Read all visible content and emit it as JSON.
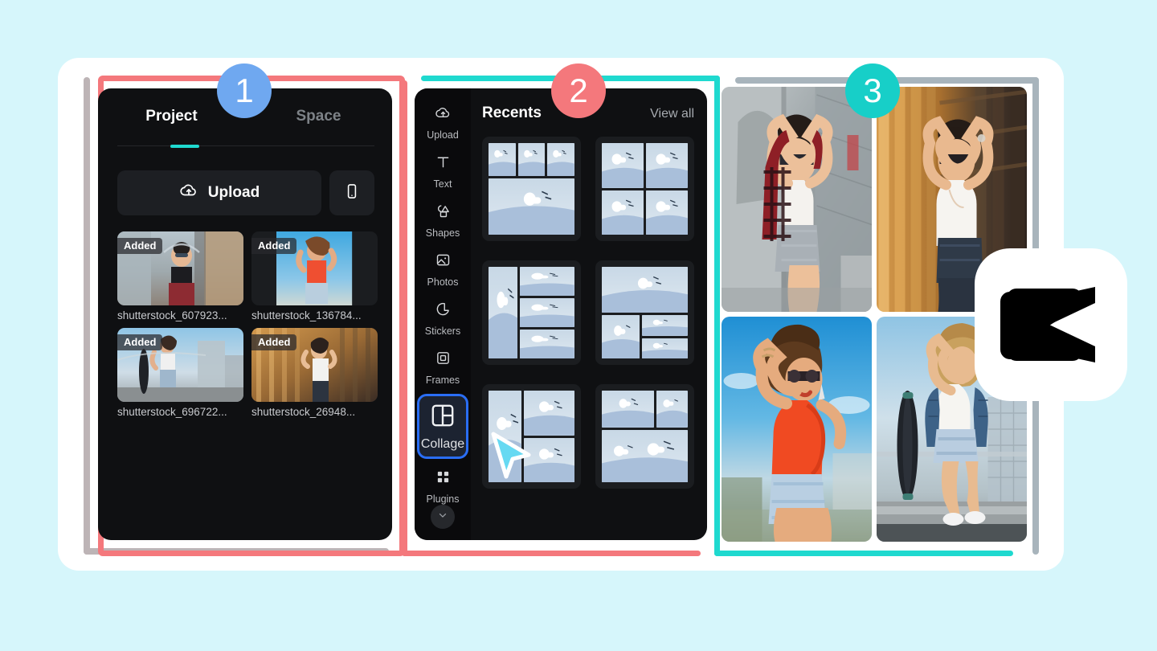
{
  "colors": {
    "background": "#d6f6fb",
    "card": "#ffffff",
    "panel": "#0f1012",
    "accent_teal": "#1fd9cf",
    "accent_red": "#f4787c",
    "accent_blue": "#6fa8f0",
    "selection_blue": "#2a6ef5",
    "gray_bracket": "#bdb4b6"
  },
  "badges": [
    {
      "label": "1",
      "color": "#6fa8f0"
    },
    {
      "label": "2",
      "color": "#f4787c"
    },
    {
      "label": "3",
      "color": "#17cfc8"
    }
  ],
  "panel_project": {
    "tabs": [
      {
        "label": "Project",
        "active": true
      },
      {
        "label": "Space",
        "active": false
      }
    ],
    "upload_label": "Upload",
    "upload_icon": "cloud-upload-icon",
    "mobile_icon": "mobile-phone-icon",
    "media": [
      {
        "badge": "Added",
        "filename": "shutterstock_607923..."
      },
      {
        "badge": "Added",
        "filename": "shutterstock_136784..."
      },
      {
        "badge": "Added",
        "filename": "shutterstock_696722..."
      },
      {
        "badge": "Added",
        "filename": "shutterstock_26948..."
      }
    ]
  },
  "panel_collage": {
    "rail": [
      {
        "label": "Upload",
        "icon": "cloud-upload-icon",
        "selected": false
      },
      {
        "label": "Text",
        "icon": "text-icon",
        "selected": false
      },
      {
        "label": "Shapes",
        "icon": "shapes-icon",
        "selected": false
      },
      {
        "label": "Photos",
        "icon": "image-icon",
        "selected": false
      },
      {
        "label": "Stickers",
        "icon": "sticker-icon",
        "selected": false
      },
      {
        "label": "Frames",
        "icon": "frame-icon",
        "selected": false
      },
      {
        "label": "Collage",
        "icon": "collage-icon",
        "selected": true
      },
      {
        "label": "Plugins",
        "icon": "grid-apps-icon",
        "selected": false
      }
    ],
    "collapse_icon": "chevron-down-icon",
    "section_title": "Recents",
    "view_all_label": "View all",
    "templates": [
      {
        "name": "collage-template-3-top-1-bottom"
      },
      {
        "name": "collage-template-2x2"
      },
      {
        "name": "collage-template-3-left-1-right"
      },
      {
        "name": "collage-template-1-top-3-bottom"
      },
      {
        "name": "collage-template-1-left-2-right"
      },
      {
        "name": "collage-template-2-top-2-bottom"
      }
    ]
  },
  "panel_preview": {
    "photos": [
      {
        "name": "photo-woman-plaid-shirt"
      },
      {
        "name": "photo-woman-wooden-wall"
      },
      {
        "name": "photo-woman-orange-top"
      },
      {
        "name": "photo-woman-longboard"
      }
    ]
  },
  "cursor": {
    "name": "mouse-pointer"
  },
  "logo": {
    "name": "capcut-logo"
  }
}
